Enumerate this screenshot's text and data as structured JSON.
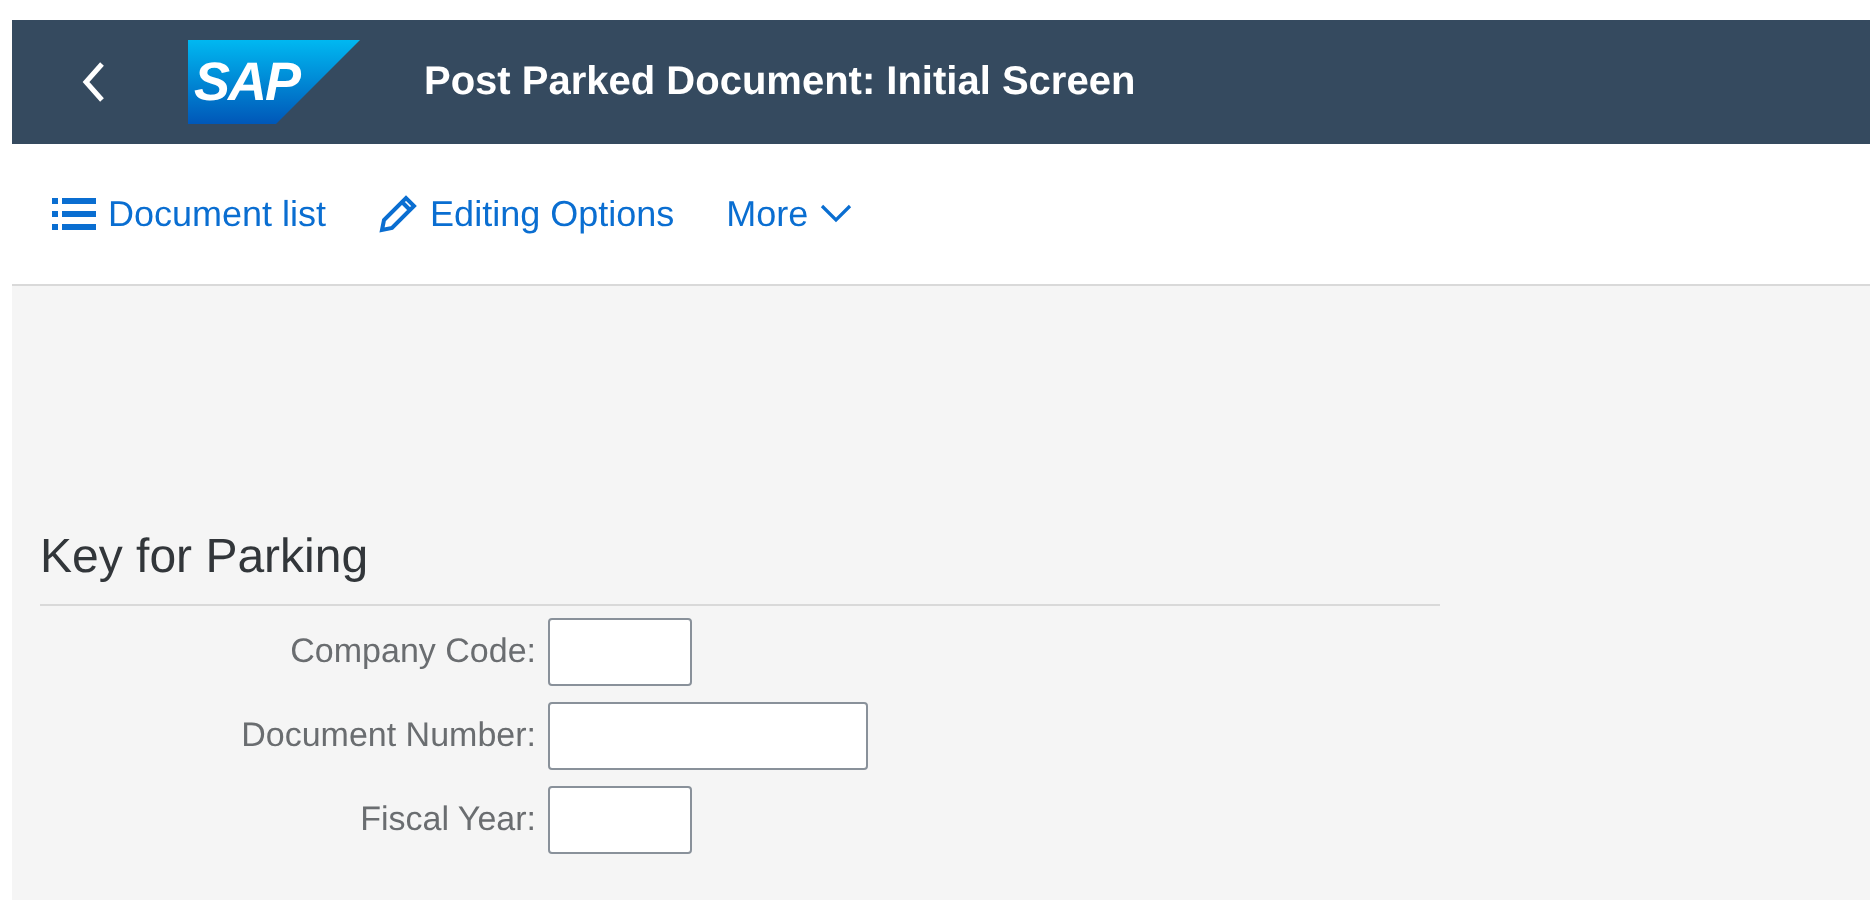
{
  "shell_bar": {
    "logo": "SAP",
    "title": "Post Parked Document: Initial Screen"
  },
  "toolbar": [
    {
      "label": "Document list",
      "kind": "list"
    },
    {
      "label": "Editing Options",
      "kind": "edit"
    },
    {
      "label": "More",
      "kind": "menu"
    }
  ],
  "section": {
    "title": "Key for Parking",
    "fields": [
      {
        "label": "Company Code:",
        "kind": "short"
      },
      {
        "label": "Document Number:",
        "kind": "long"
      },
      {
        "label": "Fiscal Year:",
        "kind": "short"
      }
    ]
  }
}
